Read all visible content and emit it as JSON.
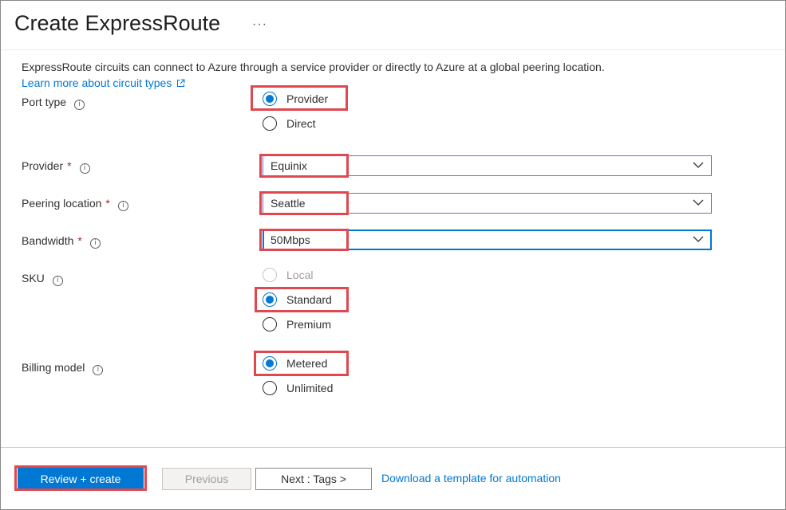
{
  "header": {
    "title": "Create ExpressRoute",
    "more_label": "···"
  },
  "intro": {
    "description": "ExpressRoute circuits can connect to Azure through a service provider or directly to Azure at a global peering location.",
    "learn_more": "Learn more about circuit types"
  },
  "form": {
    "port_type": {
      "label": "Port type",
      "options": [
        "Provider",
        "Direct"
      ],
      "selected": "Provider"
    },
    "provider": {
      "label": "Provider",
      "required_mark": "*",
      "value": "Equinix"
    },
    "peering_location": {
      "label": "Peering location",
      "required_mark": "*",
      "value": "Seattle"
    },
    "bandwidth": {
      "label": "Bandwidth",
      "required_mark": "*",
      "value": "50Mbps"
    },
    "sku": {
      "label": "SKU",
      "options": [
        "Local",
        "Standard",
        "Premium"
      ],
      "selected": "Standard",
      "disabled": [
        "Local"
      ]
    },
    "billing_model": {
      "label": "Billing model",
      "options": [
        "Metered",
        "Unlimited"
      ],
      "selected": "Metered"
    }
  },
  "footer": {
    "review_create": "Review + create",
    "previous": "Previous",
    "next": "Next : Tags >",
    "download_template": "Download a template for automation"
  },
  "colors": {
    "accent": "#0078d4",
    "highlight": "#e0484f",
    "required": "#a4262c",
    "select_border": "#8764b8"
  },
  "icons": {
    "info": "info-icon",
    "external_link": "external-link-icon",
    "dropdown": "chevron-down-icon"
  }
}
